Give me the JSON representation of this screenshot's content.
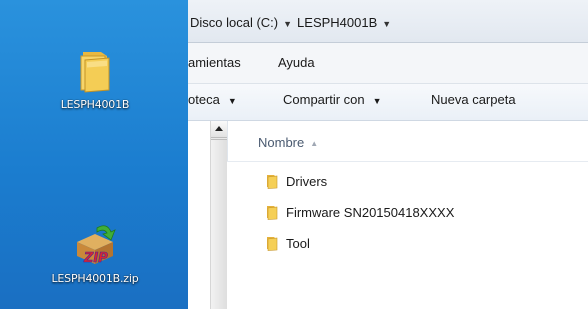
{
  "desktop": {
    "icons": [
      {
        "label": "LESPH4001B",
        "icon": "folder-icon"
      },
      {
        "label": "LESPH4001B.zip",
        "icon": "zip-archive-icon"
      }
    ]
  },
  "explorer": {
    "address": {
      "crumbs": [
        "Disco local (C:)",
        "LESPH4001B"
      ]
    },
    "menu": {
      "items": [
        "amientas",
        "Ayuda"
      ]
    },
    "toolbar": {
      "library": "oteca",
      "share": "Compartir con",
      "new_folder": "Nueva carpeta"
    },
    "columns": {
      "name": "Nombre"
    },
    "files": [
      {
        "name": "Drivers",
        "icon": "folder-icon"
      },
      {
        "name": "Firmware SN20150418XXXX",
        "icon": "folder-icon"
      },
      {
        "name": "Tool",
        "icon": "folder-icon"
      }
    ]
  },
  "colors": {
    "desktop_bg": "#1b7dcf",
    "folder_yellow": "#f3c94e"
  }
}
